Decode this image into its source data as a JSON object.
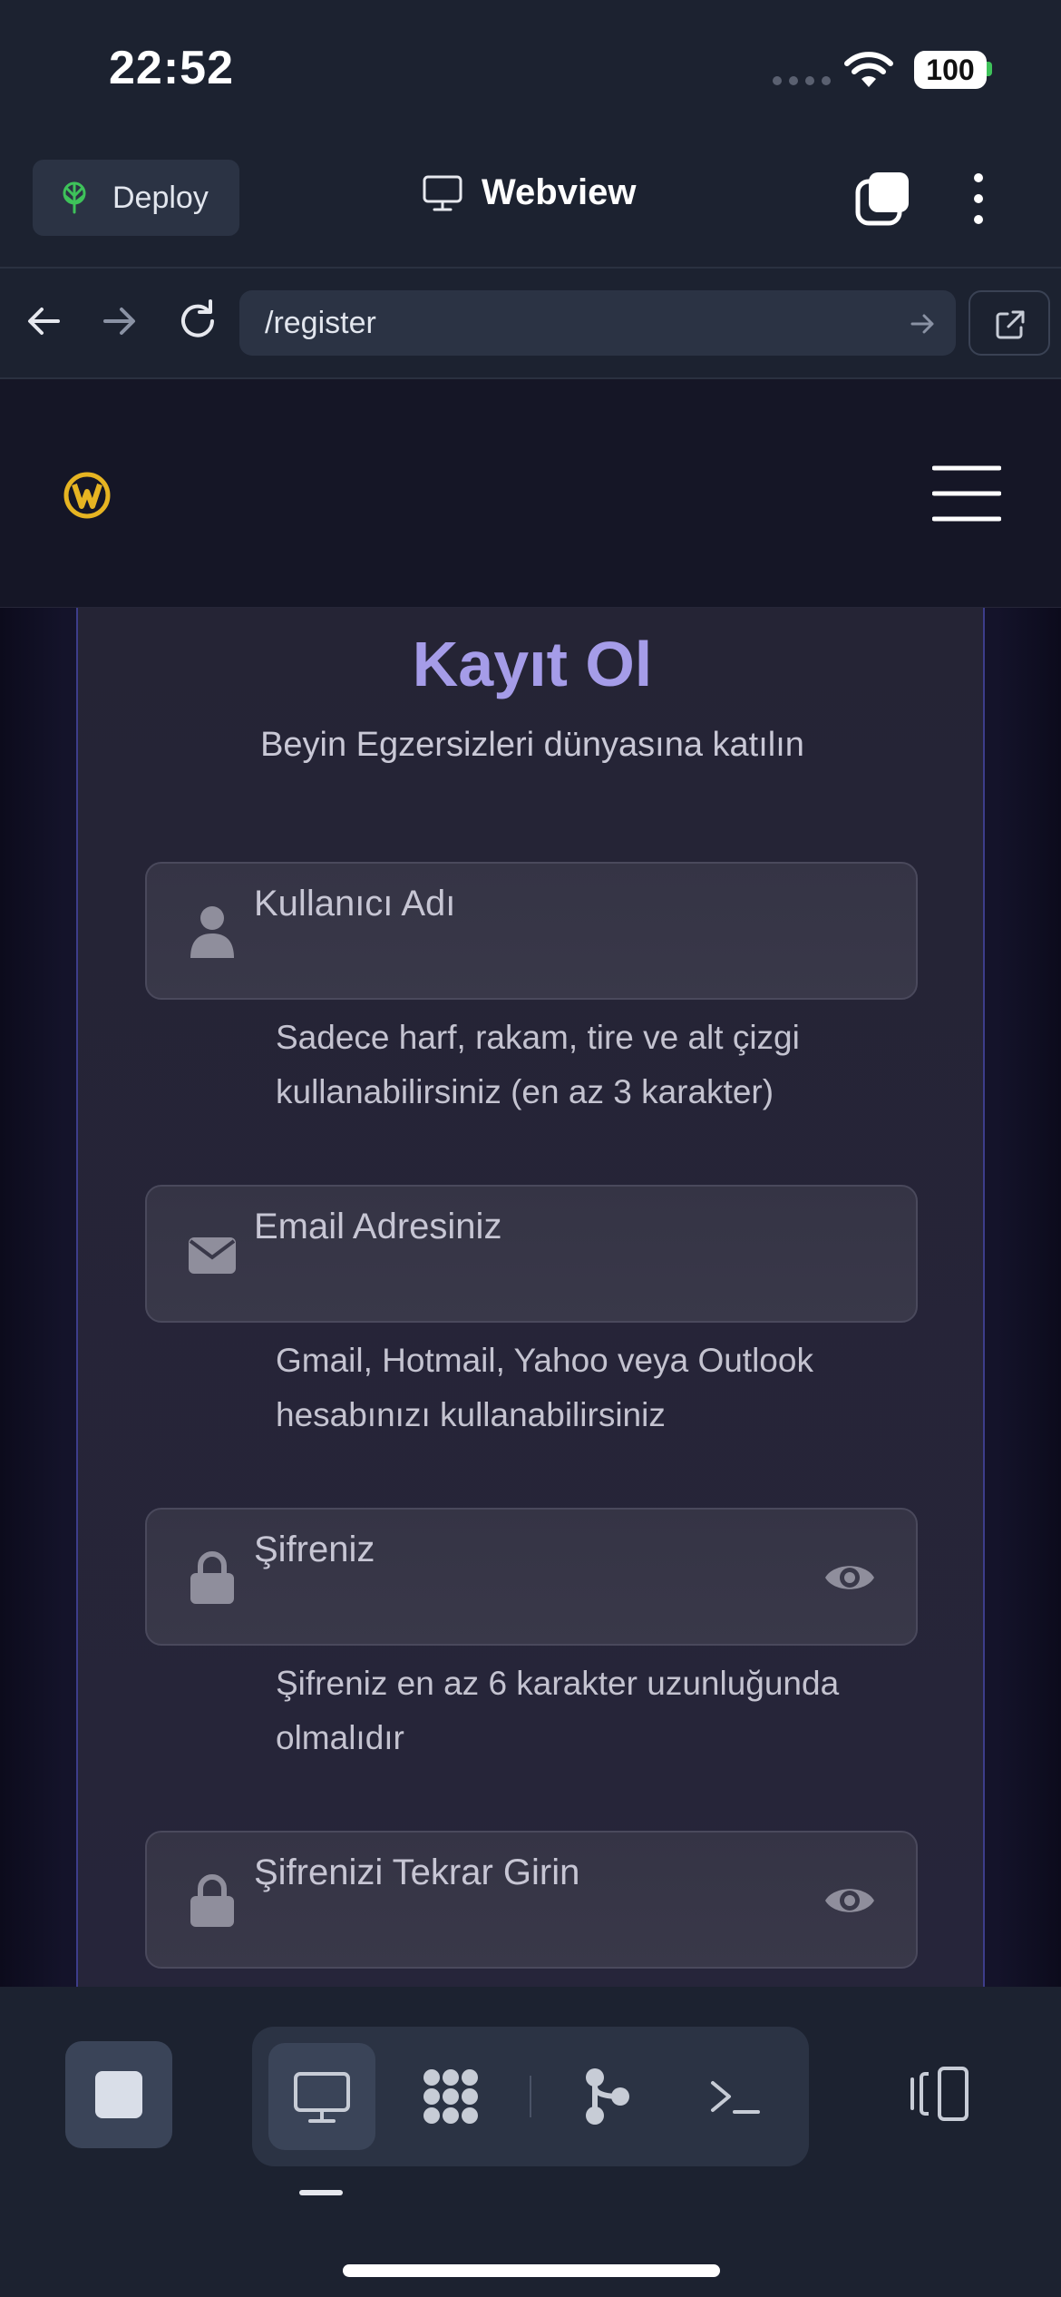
{
  "status_bar": {
    "time": "22:52",
    "battery": "100"
  },
  "toolbar": {
    "deploy_label": "Deploy",
    "title": "Webview"
  },
  "urlbar": {
    "url": "/register"
  },
  "page": {
    "title": "Kayıt Ol",
    "subtitle": "Beyin Egzersizleri dünyasına katılın",
    "fields": [
      {
        "placeholder": "Kullanıcı Adı",
        "icon": "user-icon",
        "hint": "Sadece harf, rakam, tire ve alt çizgi kullanabilirsiniz (en az 3 karakter)"
      },
      {
        "placeholder": "Email Adresiniz",
        "icon": "envelope-icon",
        "hint": "Gmail, Hotmail, Yahoo veya Outlook hesabınızı kullanabilirsiniz"
      },
      {
        "placeholder": "Şifreniz",
        "icon": "lock-icon",
        "hint": "Şifreniz en az 6 karakter uzunluğunda olmalıdır"
      },
      {
        "placeholder": "Şifrenizi Tekrar Girin",
        "icon": "lock-icon"
      }
    ]
  },
  "colors": {
    "accent": "#a59ce8",
    "deploy_green": "#3ec25a",
    "logo_gold": "#e6b422"
  },
  "dock": {
    "tools": [
      "webview-icon",
      "apps-grid-icon",
      "git-icon",
      "terminal-icon"
    ],
    "active_tool": "webview-icon"
  }
}
